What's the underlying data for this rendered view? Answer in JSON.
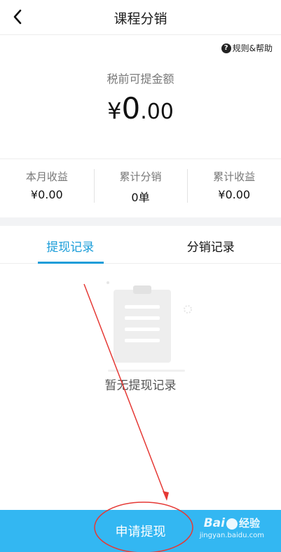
{
  "header": {
    "title": "课程分销",
    "back_icon": "chevron-left-icon"
  },
  "help": {
    "icon": "question-circle-icon",
    "label": "规则&帮助"
  },
  "balance": {
    "label": "税前可提金额",
    "currency": "¥",
    "integer": "0",
    "decimal": ".00"
  },
  "stats": [
    {
      "label": "本月收益",
      "value": "¥0.00"
    },
    {
      "label": "累计分销",
      "value": "0单"
    },
    {
      "label": "累计收益",
      "value": "¥0.00"
    }
  ],
  "tabs": [
    {
      "label": "提现记录",
      "active": true
    },
    {
      "label": "分销记录",
      "active": false
    }
  ],
  "empty_state": {
    "icon": "clipboard-icon",
    "text": "暂无提现记录"
  },
  "apply_button": {
    "label": "申请提现"
  },
  "watermark": {
    "brand": "Bai",
    "brand_suffix": "经验",
    "url": "jingyan.baidu.com"
  },
  "colors": {
    "accent": "#1b9dd9",
    "button_bg": "#33b7f2",
    "annotation": "#e53935"
  }
}
